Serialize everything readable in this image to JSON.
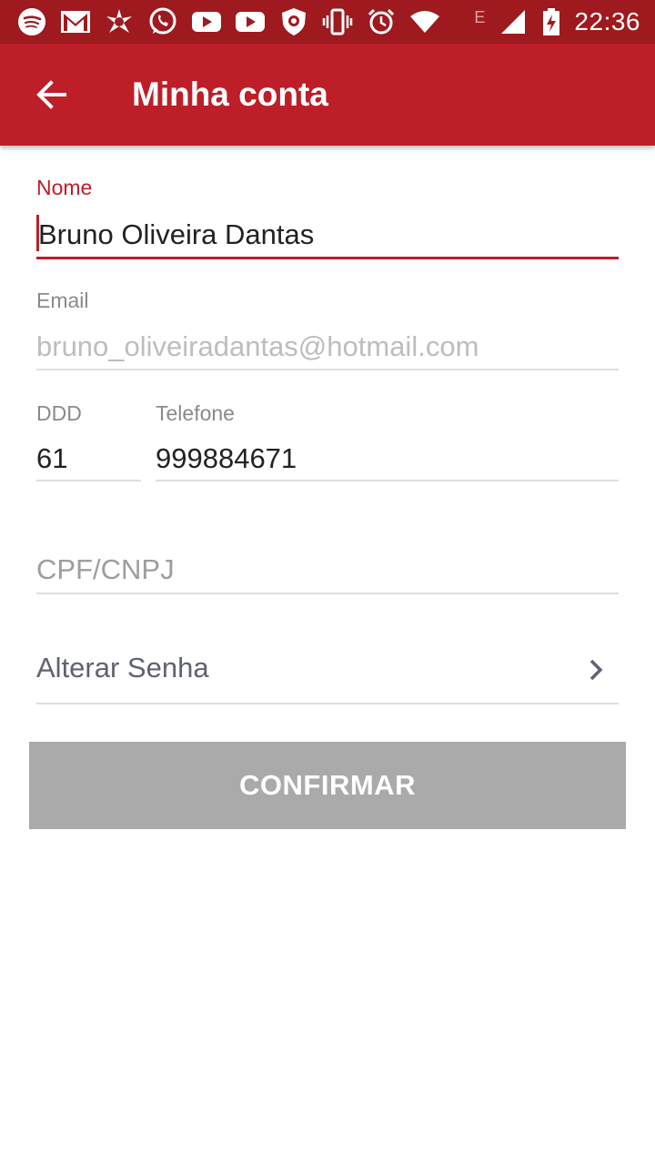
{
  "status_bar": {
    "time": "22:36",
    "network_letter": "E",
    "icons": [
      "spotify-icon",
      "gmail-icon",
      "avast-icon",
      "whatsapp-icon",
      "youtube-icon",
      "youtube-icon",
      "shield-icon",
      "vibrate-icon",
      "alarm-icon",
      "wifi-icon",
      "signal-icon",
      "battery-charging-icon"
    ]
  },
  "app_bar": {
    "title": "Minha conta",
    "back_icon": "arrow-back-icon"
  },
  "form": {
    "nome": {
      "label": "Nome",
      "value": "Bruno Oliveira Dantas"
    },
    "email": {
      "label": "Email",
      "value": "bruno_oliveiradantas@hotmail.com"
    },
    "ddd": {
      "label": "DDD",
      "value": "61"
    },
    "telefone": {
      "label": "Telefone",
      "value": "999884671"
    },
    "cpf": {
      "placeholder": "CPF/CNPJ"
    },
    "alterar_senha": {
      "label": "Alterar Senha",
      "icon": "chevron-right-icon"
    }
  },
  "confirm_button": {
    "label": "CONFIRMAR"
  },
  "colors": {
    "status_bar": "#9e1a1f",
    "app_bar": "#bd1e28",
    "accent": "#bd1e28",
    "button_disabled": "#aaaaaa"
  }
}
